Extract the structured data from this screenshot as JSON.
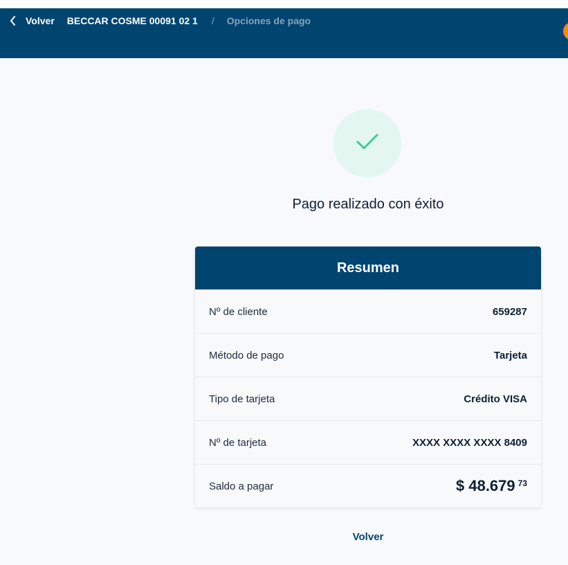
{
  "header": {
    "back_label": "Volver",
    "account": "BECCAR COSME 00091 02 1",
    "separator": "/",
    "current": "Opciones de pago"
  },
  "colors": {
    "brand": "#004470",
    "success_bg": "#e3f6ef",
    "success_check": "#3dc99a",
    "accent_orange": "#f08a1c"
  },
  "status": {
    "icon": "check-icon",
    "title": "Pago realizado con éxito"
  },
  "summary": {
    "title": "Resumen",
    "rows": [
      {
        "label": "Nº de cliente",
        "value": "659287"
      },
      {
        "label": "Método de pago",
        "value": "Tarjeta"
      },
      {
        "label": "Tipo de tarjeta",
        "value": "Crédito VISA"
      },
      {
        "label": "Nº de tarjeta",
        "value": "XXXX XXXX XXXX 8409"
      }
    ],
    "total": {
      "label": "Saldo a pagar",
      "amount": "$ 48.679",
      "cents": "73"
    }
  },
  "footer": {
    "back_label": "Volver"
  }
}
